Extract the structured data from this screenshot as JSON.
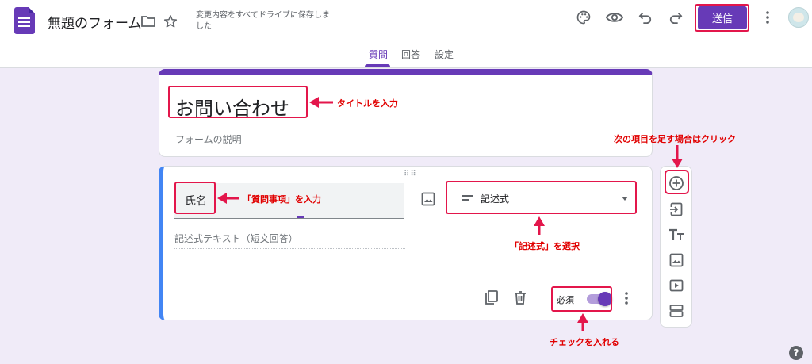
{
  "header": {
    "form_title": "無題のフォーム",
    "save_status": "変更内容をすべてドライブに保存しました",
    "send_label": "送信",
    "icons": [
      "folder-icon",
      "star-icon",
      "palette-icon",
      "eye-icon",
      "undo-icon",
      "redo-icon",
      "more-vert-icon",
      "avatar"
    ]
  },
  "tabs": [
    {
      "label": "質問",
      "active": true
    },
    {
      "label": "回答",
      "active": false
    },
    {
      "label": "設定",
      "active": false
    }
  ],
  "title_card": {
    "title": "お問い合わせ",
    "description_placeholder": "フォームの説明"
  },
  "question_card": {
    "question": "氏名",
    "type": "記述式",
    "answer_placeholder": "記述式テキスト（短文回答）",
    "required_label": "必須",
    "required": true
  },
  "annotations": {
    "title": "タイトルを入力",
    "question": "「質問事項」を入力",
    "add_item": "次の項目を足す場合はクリック",
    "type_select": "「記述式」を選択",
    "required": "チェックを入れる"
  },
  "colors": {
    "accent": "#673ab7",
    "background": "#f0ebf8",
    "annotation": "#e3164b",
    "question_bar": "#4285f4"
  },
  "help_label": "?"
}
